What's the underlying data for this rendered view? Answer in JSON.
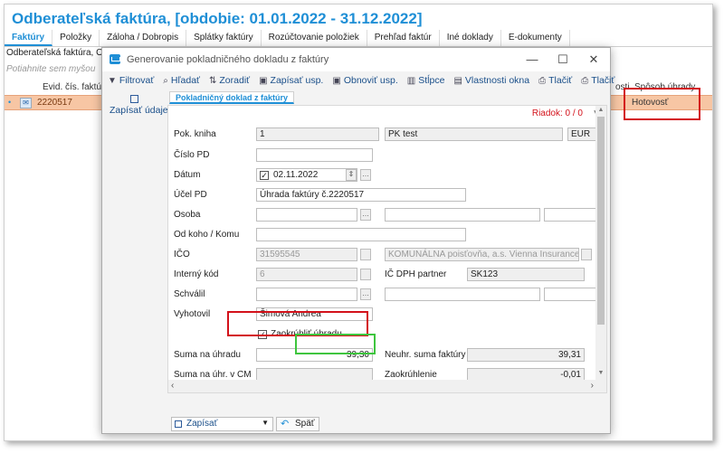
{
  "app": {
    "title": "Odberateľská faktúra, [obdobie: 01.01.2022 - 31.12.2022]",
    "tabs": [
      "Faktúry",
      "Položky",
      "Záloha / Dobropis",
      "Splátky faktúry",
      "Rozúčtovanie položiek",
      "Prehľad faktúr",
      "Iné doklady",
      "E-dokumenty"
    ],
    "subtitle": "Odberateľská faktúra, Obc",
    "drag_hint": "Potiahnite sem myšou",
    "col_evid": "Evid. čís. faktúry",
    "col_osti": "osti",
    "col_payment": "Spôsob úhrady",
    "row_number": "2220517",
    "row_payment": "Hotovosť"
  },
  "dialog": {
    "title": "Generovanie pokladničného dokladu z faktúry",
    "toolbar": [
      "Filtrovať",
      "Hľadať",
      "Zoradiť",
      "Zapísať usp.",
      "Obnoviť usp.",
      "Stĺpce",
      "Vlastnosti okna",
      "Tlačiť",
      "Tlačiť"
    ],
    "sidebar_save": "Zapísať údaje",
    "tab_label": "Pokladničný doklad z faktúry",
    "row_counter": "Riadok: 0 / 0",
    "fields": {
      "pok_kniha_label": "Pok. kniha",
      "pok_kniha_value": "1",
      "pok_kniha_name": "PK test",
      "currency": "EUR",
      "cislo_pd_label": "Číslo PD",
      "datum_label": "Dátum",
      "datum_value": "02.11.2022",
      "ucel_label": "Účel PD",
      "ucel_value": "Úhrada faktúry č.2220517",
      "osoba_label": "Osoba",
      "od_koho_label": "Od koho / Komu",
      "ico_label": "IČO",
      "ico_value": "31595545",
      "ico_name": "KOMUNÁLNA poisťovňa, a.s. Vienna Insurance Grc",
      "interny_kod_label": "Interný kód",
      "interny_kod_value": "6",
      "ic_dph_label": "IČ DPH partner",
      "ic_dph_value": "SK123",
      "schvalil_label": "Schválil",
      "vyhotovil_label": "Vyhotovil",
      "vyhotovil_value": "Šimová Andrea",
      "zaokruhlit_label": "Zaokrúhliť úhradu",
      "suma_label": "Suma na úhradu",
      "suma_value": "39,30",
      "neuhr_label": "Neuhr. suma faktúry",
      "neuhr_value": "39,31",
      "suma_cm_label": "Suma na úhr. v CM",
      "zaokruhlenie_label": "Zaokrúhlenie",
      "zaokruhlenie_value": "-0,01"
    },
    "footer_save": "Zapísať",
    "footer_back": "Späť"
  },
  "colors": {
    "accent_blue": "#1f8fd6",
    "highlight_red": "#d3111a",
    "highlight_green": "#3ec53e",
    "row_selected": "#f7c6a4"
  }
}
